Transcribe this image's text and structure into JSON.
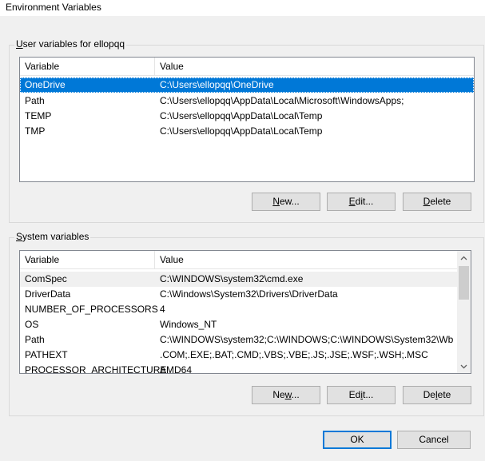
{
  "window": {
    "title": "Environment Variables"
  },
  "user_vars": {
    "group_label_prefix": "",
    "group_label_key": "U",
    "group_label_rest": "ser variables for ellopqq",
    "columns": [
      "Variable",
      "Value"
    ],
    "rows": [
      {
        "name": "OneDrive",
        "value": "C:\\Users\\ellopqq\\OneDrive",
        "selected": true
      },
      {
        "name": "Path",
        "value": "C:\\Users\\ellopqq\\AppData\\Local\\Microsoft\\WindowsApps;"
      },
      {
        "name": "TEMP",
        "value": "C:\\Users\\ellopqq\\AppData\\Local\\Temp"
      },
      {
        "name": "TMP",
        "value": "C:\\Users\\ellopqq\\AppData\\Local\\Temp"
      }
    ],
    "buttons": {
      "new_pre": "",
      "new_key": "N",
      "new_post": "ew...",
      "edit_pre": "",
      "edit_key": "E",
      "edit_post": "dit...",
      "delete_pre": "",
      "delete_key": "D",
      "delete_post": "elete"
    }
  },
  "system_vars": {
    "group_label_prefix": "",
    "group_label_key": "S",
    "group_label_rest": "ystem variables",
    "columns": [
      "Variable",
      "Value"
    ],
    "rows": [
      {
        "name": "ComSpec",
        "value": "C:\\WINDOWS\\system32\\cmd.exe"
      },
      {
        "name": "DriverData",
        "value": "C:\\Windows\\System32\\Drivers\\DriverData"
      },
      {
        "name": "NUMBER_OF_PROCESSORS",
        "value": "4"
      },
      {
        "name": "OS",
        "value": "Windows_NT"
      },
      {
        "name": "Path",
        "value": "C:\\WINDOWS\\system32;C:\\WINDOWS;C:\\WINDOWS\\System32\\Wb..."
      },
      {
        "name": "PATHEXT",
        "value": ".COM;.EXE;.BAT;.CMD;.VBS;.VBE;.JS;.JSE;.WSF;.WSH;.MSC"
      },
      {
        "name": "PROCESSOR_ARCHITECTURE",
        "value": "AMD64"
      }
    ],
    "buttons": {
      "new_pre": "Ne",
      "new_key": "w",
      "new_post": "...",
      "edit_pre": "Ed",
      "edit_key": "i",
      "edit_post": "t...",
      "delete_pre": "De",
      "delete_key": "l",
      "delete_post": "ete"
    }
  },
  "dialog_buttons": {
    "ok": "OK",
    "cancel": "Cancel"
  },
  "icons": {
    "scroll_up": "chevron-up-icon",
    "scroll_down": "chevron-down-icon"
  },
  "colors": {
    "selection": "#0078d7",
    "default_button_border": "#0078d7"
  }
}
